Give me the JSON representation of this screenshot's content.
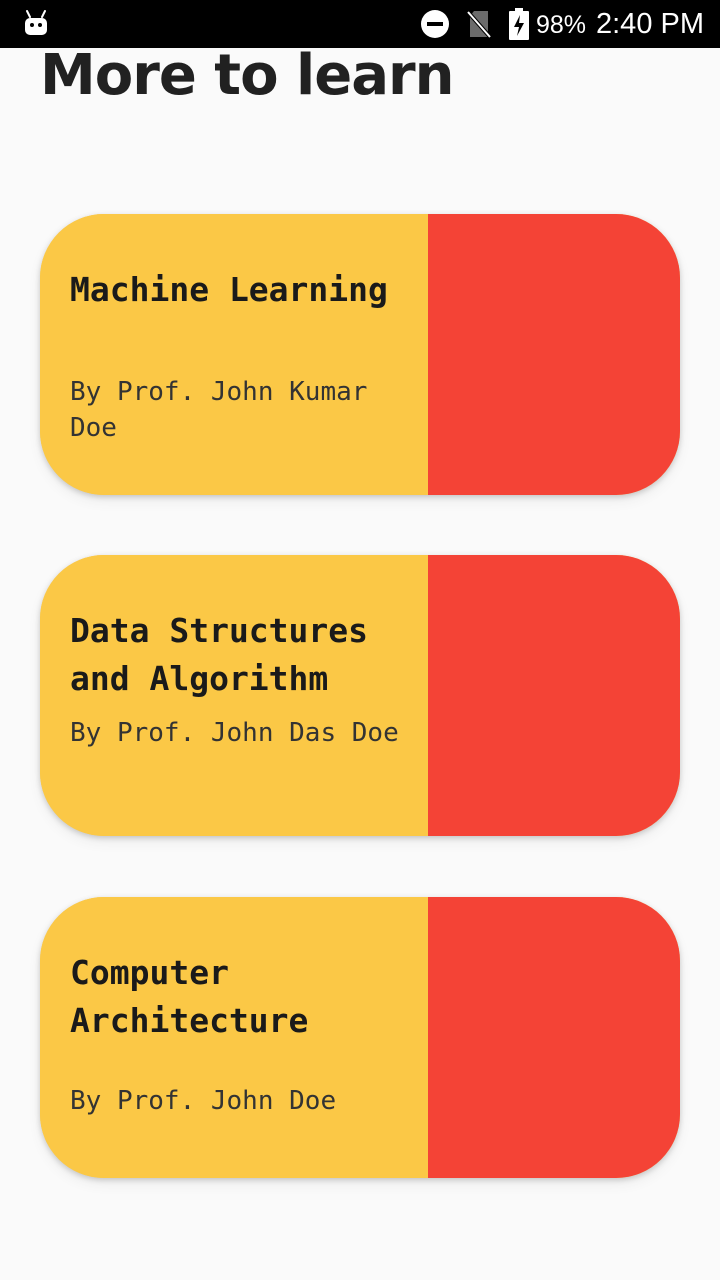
{
  "status_bar": {
    "battery_percent": "98%",
    "time": "2:40 PM",
    "icons": [
      "android-icon",
      "do-not-disturb-icon",
      "no-sim-icon",
      "battery-charging-icon"
    ]
  },
  "page": {
    "title": "More to learn"
  },
  "colors": {
    "background": "#fafafa",
    "card_info": "#fbc846",
    "card_image": "#f44336",
    "title_text": "#212121"
  },
  "courses": [
    {
      "title": "Machine Learning",
      "author": "By Prof. John Kumar Doe"
    },
    {
      "title": "Data Structures and Algorithm",
      "author": "By Prof. John Das Doe"
    },
    {
      "title": "Computer Architecture",
      "author": "By Prof. John Doe"
    }
  ]
}
